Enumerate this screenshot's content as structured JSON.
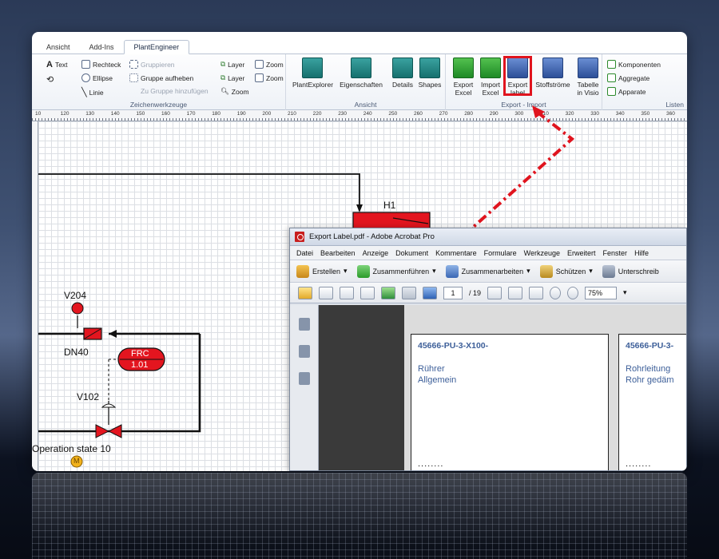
{
  "visio": {
    "tabs": [
      {
        "label": "Ansicht",
        "active": false
      },
      {
        "label": "Add-Ins",
        "active": false
      },
      {
        "label": "PlantEngineer",
        "active": true
      }
    ],
    "groups": {
      "zeichenwerkzeuge": {
        "title": "Zeichenwerkzeuge",
        "text": "Text",
        "rechteck": "Rechteck",
        "ellipse": "Ellipse",
        "linie": "Linie",
        "gruppieren": "Gruppieren",
        "gruppe_aufheben": "Gruppe aufheben",
        "zu_gruppe": "Zu Gruppe hinzufügen",
        "layer1": "Layer",
        "layer2": "Layer",
        "zoom1": "Zoom",
        "zoom2": "Zoom",
        "zoom3": "Zoom"
      },
      "ansicht": {
        "title": "Ansicht",
        "plantexplorer": "PlantExplorer",
        "eigenschaften": "Eigenschaften",
        "details": "Details",
        "shapes": "Shapes"
      },
      "export_import": {
        "title": "Export - Import",
        "export_excel_1": "Export",
        "export_excel_2": "Excel",
        "import_excel_1": "Import",
        "import_excel_2": "Excel",
        "export_label_1": "Export",
        "export_label_2": "label",
        "stoffstroeme": "Stoffströme",
        "tabelle_1": "Tabelle",
        "tabelle_2": "in Visio"
      },
      "listen": {
        "title": "Listen",
        "komponenten": "Komponenten",
        "aggregate": "Aggregate",
        "apparate": "Apparate"
      }
    },
    "ruler_ticks": [
      "10",
      "120",
      "130",
      "140",
      "150",
      "160",
      "170",
      "180",
      "190",
      "200",
      "210",
      "220",
      "230",
      "240",
      "250",
      "260",
      "270",
      "280",
      "290",
      "300",
      "310",
      "320",
      "330",
      "340",
      "350",
      "360"
    ],
    "diagram": {
      "h1": "H1",
      "v204": "V204",
      "dn40": "DN40",
      "frc_1": "FRC",
      "frc_2": "1.01",
      "v102": "V102",
      "operation_state": "Operation state 10",
      "motor": "M"
    }
  },
  "acrobat": {
    "title": "Export Label.pdf - Adobe Acrobat Pro",
    "menu": [
      "Datei",
      "Bearbeiten",
      "Anzeige",
      "Dokument",
      "Kommentare",
      "Formulare",
      "Werkzeuge",
      "Erweitert",
      "Fenster",
      "Hilfe"
    ],
    "toolbar1": {
      "erstellen": "Erstellen",
      "zusammenfuehren": "Zusammenführen",
      "zusammenarbeiten": "Zusammenarbeiten",
      "schuetzen": "Schützen",
      "unterschreiben": "Unterschreib"
    },
    "toolbar2": {
      "page": "1",
      "page_total": "/ 19",
      "zoom": "75%"
    },
    "labels": [
      {
        "code": "45666-PU-3-X100-",
        "line1": "Rührer",
        "line2": "Allgemein",
        "dots": "........"
      },
      {
        "code": "45666-PU-3-",
        "line1": "Rohrleitung",
        "line2": "Rohr gedäm",
        "dots": "........"
      }
    ]
  },
  "colors": {
    "highlight": "#e0141e",
    "symbol_red": "#e3151f",
    "motor_yellow": "#f2b21c",
    "label_text": "#3d5f99"
  }
}
